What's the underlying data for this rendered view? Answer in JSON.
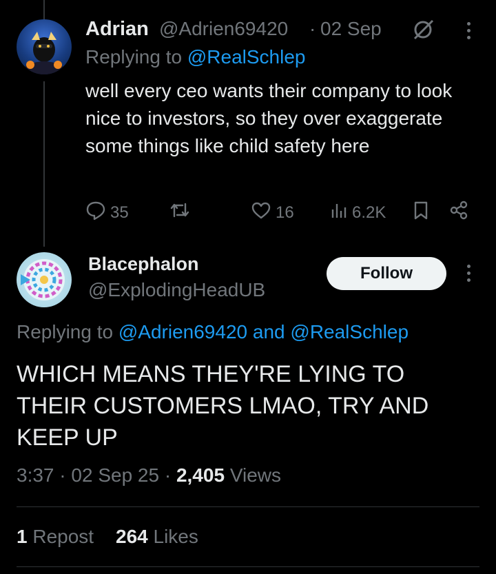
{
  "reply_tweet": {
    "display_name": "Adrian",
    "handle": "@Adrien69420",
    "separator": "·",
    "date": "02 Sep",
    "replying_prefix": "Replying to",
    "replying_to": "@RealSchlep",
    "text": "well every ceo wants their company to look nice to investors, so they over exaggerate some things like child safety here",
    "actions": {
      "replies": "35",
      "likes": "16",
      "views": "6.2K"
    },
    "icons": [
      "grok-icon",
      "more-icon",
      "reply-icon",
      "repost-icon",
      "like-icon",
      "views-icon",
      "bookmark-icon",
      "share-icon"
    ]
  },
  "main_tweet": {
    "display_name": "Blacephalon",
    "handle": "@ExplodingHeadUB",
    "follow_label": "Follow",
    "replying_prefix": "Replying to",
    "mention_1": "@Adrien69420",
    "and_word": "and",
    "mention_2": "@RealSchlep",
    "text": "WHICH MEANS THEY'RE LYING TO THEIR CUSTOMERS LMAO, TRY AND KEEP UP",
    "time": "3:37",
    "sep1": "·",
    "date": "02 Sep 25",
    "sep2": "·",
    "views_count": "2,405",
    "views_label": "Views",
    "reposts_count": "1",
    "reposts_label": "Repost",
    "likes_count": "264",
    "likes_label": "Likes"
  },
  "colors": {
    "background": "#000000",
    "text": "#e7e9ea",
    "muted": "#71767b",
    "link": "#1d9bf0",
    "divider": "#2f3336"
  }
}
